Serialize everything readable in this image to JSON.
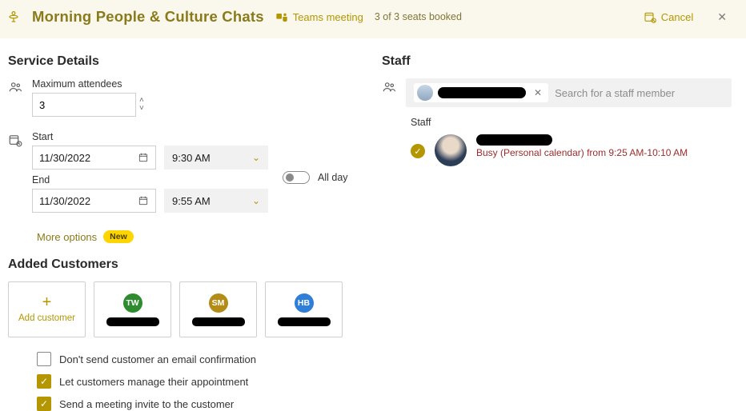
{
  "header": {
    "title": "Morning People & Culture Chats",
    "teams_label": "Teams meeting",
    "seats_label": "3 of 3 seats booked",
    "cancel_label": "Cancel"
  },
  "service": {
    "section_title": "Service Details",
    "max_label": "Maximum attendees",
    "max_value": "3",
    "start_label": "Start",
    "start_date": "11/30/2022",
    "start_time": "9:30 AM",
    "end_label": "End",
    "end_date": "11/30/2022",
    "end_time": "9:55 AM",
    "allday_label": "All day",
    "more_options_label": "More options",
    "new_pill": "New"
  },
  "customers": {
    "section_title": "Added Customers",
    "add_label": "Add customer",
    "items": [
      {
        "initials": "TW",
        "color": "#2e8b2e"
      },
      {
        "initials": "SM",
        "color": "#b28c16"
      },
      {
        "initials": "HB",
        "color": "#2f7ed8"
      }
    ],
    "options": [
      {
        "label": "Don't send customer an email confirmation",
        "checked": false
      },
      {
        "label": "Let customers manage their appointment",
        "checked": true
      },
      {
        "label": "Send a meeting invite to the customer",
        "checked": true
      }
    ]
  },
  "staff": {
    "section_title": "Staff",
    "search_placeholder": "Search for a staff member",
    "sub_label": "Staff",
    "busy_text": "Busy (Personal calendar) from 9:25 AM-10:10 AM"
  }
}
